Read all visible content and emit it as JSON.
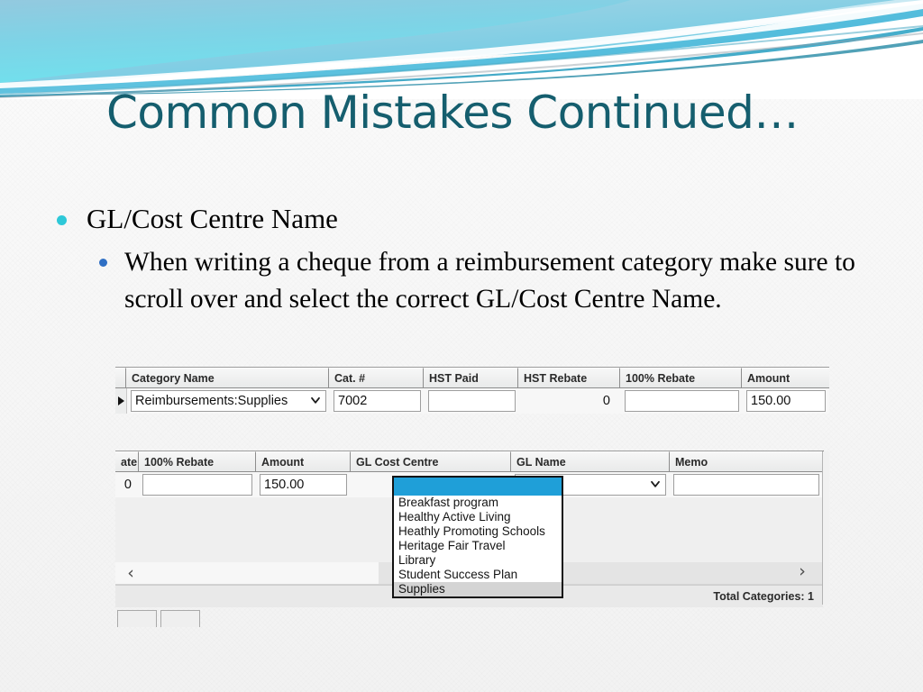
{
  "slide": {
    "title": "Common Mistakes Continued…",
    "title_color": "#155e6e",
    "bullets": [
      {
        "level": 1,
        "text": "GL/Cost Centre Name",
        "bullet_color": "#2ec8d8"
      },
      {
        "level": 2,
        "text": "When writing a cheque from a reimbursement category make sure to scroll over and select the correct GL/Cost Centre Name.",
        "bullet_color": "#2f6fc4"
      }
    ],
    "banner_colors": {
      "top_left": "#8fc9de",
      "cyan": "#6fdcea",
      "mid_blue": "#6ec6e2",
      "deep_teal": "#2196b5",
      "pale": "#d9f0f4"
    }
  },
  "grid1": {
    "columns": [
      "Category Name",
      "Cat. #",
      "HST Paid",
      "HST Rebate",
      "100% Rebate",
      "Amount"
    ],
    "row": {
      "category_name": "Reimbursements:Supplies",
      "cat_number": "7002",
      "hst_paid": "",
      "hst_rebate": "0",
      "rebate_100": "",
      "amount": "150.00"
    },
    "row_marker_icon": "row-selector-triangle-icon",
    "category_dropdown_icon": "chevron-down-icon"
  },
  "grid2": {
    "columns": [
      "ate",
      "100% Rebate",
      "Amount",
      "GL Cost Centre",
      "GL Name",
      "Memo"
    ],
    "row": {
      "hst_rebate": "0",
      "rebate_100": "",
      "amount": "150.00",
      "gl_cost_centre": "",
      "gl_name": "",
      "memo": ""
    },
    "gl_name_dropdown_icon": "chevron-down-icon",
    "dropdown": {
      "name": "gl-cost-centre-dropdown",
      "selected": "",
      "options": [
        "Breakfast program",
        "Healthy Active Living",
        "Heathly Promoting Schools",
        "Heritage Fair Travel",
        "Library",
        "Student Success Plan",
        "Supplies"
      ],
      "hovered_option": "Supplies",
      "highlight_color": "#1f9fd8",
      "hover_color": "#d4d4d4"
    },
    "scrollbar": {
      "left_arrow": "‹",
      "right_arrow": "›"
    },
    "status_text": "Total Categories: 1"
  }
}
